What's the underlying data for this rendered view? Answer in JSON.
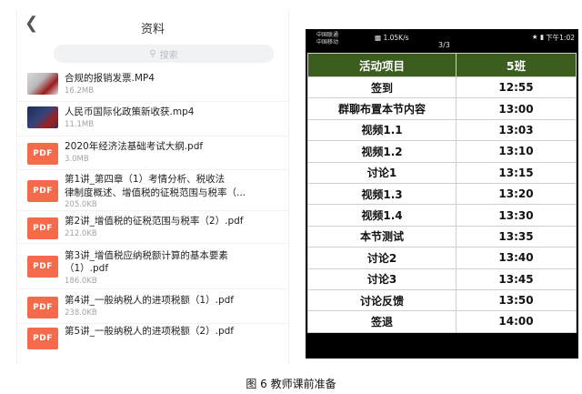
{
  "left_screen": {
    "title": "资料",
    "back_icon": "chevron-left-icon",
    "search": {
      "placeholder": "搜索",
      "icon": "search-icon"
    },
    "files": [
      {
        "thumb": "video",
        "name": "合规的报销发票.MP4",
        "size": "16.2MB"
      },
      {
        "thumb": "video",
        "name": "人民币国际化政策新收获.mp4",
        "size": "11.1MB"
      },
      {
        "thumb": "PDF",
        "name": "2020年经济法基础考试大纲.pdf",
        "size": "3.0MB"
      },
      {
        "thumb": "PDF",
        "name_line1": "第1讲_第四章（1）考情分析、税收法",
        "name_line2": "律制度概述、增值税的征税范围与税率（...",
        "size": "205.0KB"
      },
      {
        "thumb": "PDF",
        "name": "第2讲_增值税的征税范围与税率（2）.pdf",
        "size": "212.0KB"
      },
      {
        "thumb": "PDF",
        "name_line1": "第3讲_增值税应纳税额计算的基本要素",
        "name_line2": "（1）.pdf",
        "size": "186.0KB"
      },
      {
        "thumb": "PDF",
        "name": "第4讲_一般纳税人的进项税额（1）.pdf",
        "size": "238.0KB"
      },
      {
        "thumb": "PDF",
        "name": "第5讲_一般纳税人的进项税额（2）.pdf",
        "size": ""
      }
    ],
    "pdf_color": "#f46b4c"
  },
  "right_screen": {
    "status_bar": {
      "carrier_line1": "中国联通",
      "carrier_line2": "中国移动",
      "net_speed": "1.05K/s",
      "page_indicator": "3/3",
      "clock": "下午1:02"
    },
    "table": {
      "headers": [
        "活动项目",
        "5班"
      ],
      "rows": [
        [
          "签到",
          "12:55"
        ],
        [
          "群聊布置本节内容",
          "13:00"
        ],
        [
          "视频1.1",
          "13:03"
        ],
        [
          "视频1.2",
          "13:10"
        ],
        [
          "讨论1",
          "13:15"
        ],
        [
          "视频1.3",
          "13:20"
        ],
        [
          "视频1.4",
          "13:30"
        ],
        [
          "本节测试",
          "13:35"
        ],
        [
          "讨论2",
          "13:40"
        ],
        [
          "讨论3",
          "13:45"
        ],
        [
          "讨论反馈",
          "13:50"
        ],
        [
          "签退",
          "14:00"
        ]
      ]
    },
    "header_color": "#3b5e1f"
  },
  "caption": "图 6  教师课前准备"
}
